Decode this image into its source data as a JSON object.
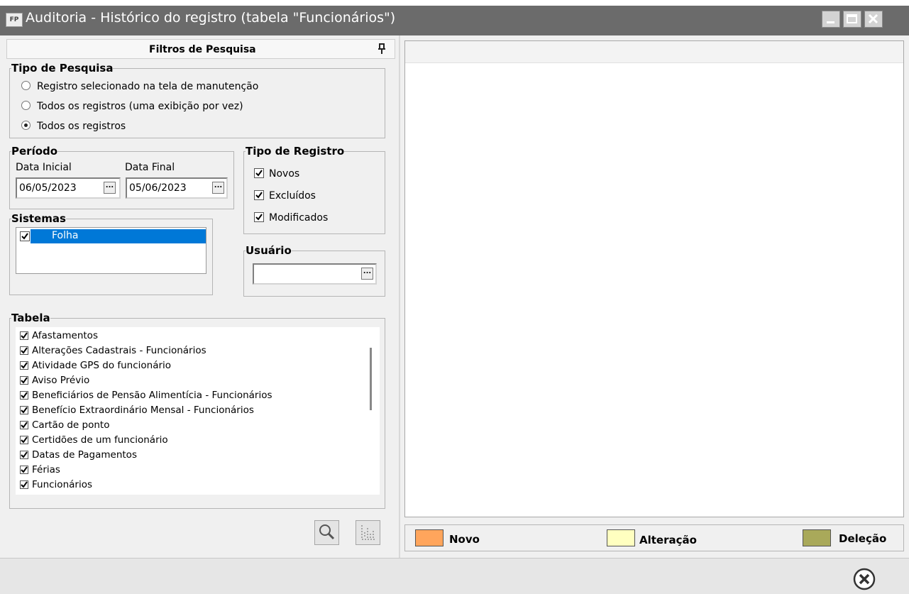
{
  "window": {
    "title": "Auditoria - Histórico do registro (tabela \"Funcionários\")",
    "app_icon": "FP"
  },
  "filters": {
    "header": "Filtros de Pesquisa",
    "search_type": {
      "legend": "Tipo de Pesquisa",
      "options": [
        {
          "label": "Registro selecionado na tela de manutenção",
          "selected": false
        },
        {
          "label": "Todos os registros (uma exibição por vez)",
          "selected": false
        },
        {
          "label": "Todos os registros",
          "selected": true
        }
      ]
    },
    "period": {
      "legend": "Período",
      "start_label": "Data Inicial",
      "start_value": "06/05/2023",
      "end_label": "Data Final",
      "end_value": "05/06/2023",
      "ellipsis": "..."
    },
    "record_type": {
      "legend": "Tipo de Registro",
      "items": [
        {
          "label": "Novos",
          "checked": true
        },
        {
          "label": "Excluídos",
          "checked": true
        },
        {
          "label": "Modificados",
          "checked": true
        }
      ]
    },
    "systems": {
      "legend": "Sistemas",
      "items": [
        {
          "label": "Folha",
          "checked": true,
          "selected": true
        }
      ]
    },
    "user": {
      "legend": "Usuário",
      "value": "",
      "ellipsis": "..."
    },
    "table": {
      "legend": "Tabela",
      "items": [
        "Afastamentos",
        "Alterações Cadastrais - Funcionários",
        "Atividade GPS do funcionário",
        "Aviso Prévio",
        "Beneficiários de Pensão Alimentícia - Funcionários",
        "Benefício Extraordinário Mensal - Funcionários",
        "Cartão de ponto",
        "Certidões de um funcionário",
        "Datas de Pagamentos",
        "Férias",
        "Funcionários"
      ]
    }
  },
  "legend": {
    "items": [
      {
        "label": "Novo",
        "color": "#ffa55c"
      },
      {
        "label": "Alteração",
        "color": "#ffffc0"
      },
      {
        "label": "Deleção",
        "color": "#a9a95a"
      }
    ]
  },
  "colors": {
    "titlebar": "#6b6b6b",
    "selection": "#0078d7"
  }
}
